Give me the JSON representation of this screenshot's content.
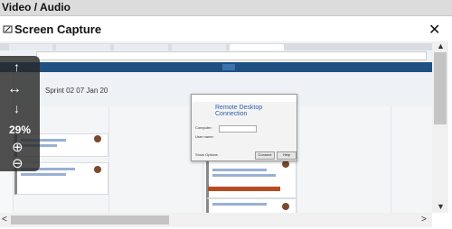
{
  "window": {
    "section_title": "Video / Audio",
    "dialog_title": "Screen Capture",
    "close_glyph": "✕"
  },
  "viewer": {
    "zoom_level": "29%",
    "controls": {
      "pan_up": "↑",
      "pan_horizontal": "↔",
      "pan_down": "↓",
      "zoom_in": "⊕",
      "zoom_out": "⊖"
    }
  },
  "scrollbars": {
    "up": "▲",
    "down": "▼",
    "left": "<",
    "right": ">"
  },
  "captured_screen": {
    "board_title": "Sprint 02 07 Jan 20",
    "dialog": {
      "brand_line1": "Remote Desktop",
      "brand_line2": "Connection",
      "computer_label": "Computer:",
      "username_label": "User name:",
      "ok_label": "Connect",
      "help_label": "Help",
      "show_options": "Show Options"
    }
  },
  "colors": {
    "jira_nav": "#205081",
    "overlay": "#282828",
    "scroll_thumb": "#c4c4c4"
  }
}
